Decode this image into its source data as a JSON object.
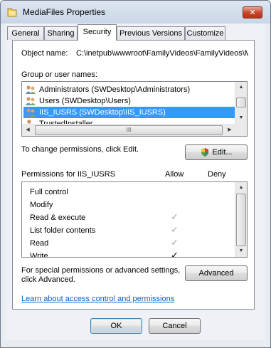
{
  "window": {
    "title": "MediaFiles Properties"
  },
  "tabs": [
    {
      "label": "General"
    },
    {
      "label": "Sharing"
    },
    {
      "label": "Security",
      "active": true
    },
    {
      "label": "Previous Versions"
    },
    {
      "label": "Customize"
    }
  ],
  "object": {
    "label": "Object name:",
    "value": "C:\\inetpub\\wwwroot\\FamilyVideos\\FamilyVideos\\M"
  },
  "groups": {
    "label": "Group or user names:",
    "items": [
      {
        "name": "Administrators (SWDesktop\\Administrators)"
      },
      {
        "name": "Users (SWDesktop\\Users)"
      },
      {
        "name": "IIS_IUSRS (SWDesktop\\IIS_IUSRS)",
        "selected": true
      },
      {
        "name": "TrustedInstaller"
      }
    ],
    "hscroll_grip": "III"
  },
  "change_perms": {
    "text": "To change permissions, click Edit.",
    "edit_label": "Edit..."
  },
  "permissions": {
    "title": "Permissions for IIS_IUSRS",
    "allow_header": "Allow",
    "deny_header": "Deny",
    "rows": [
      {
        "name": "Full control",
        "allow": "none"
      },
      {
        "name": "Modify",
        "allow": "none"
      },
      {
        "name": "Read & execute",
        "allow": "inherited"
      },
      {
        "name": "List folder contents",
        "allow": "inherited"
      },
      {
        "name": "Read",
        "allow": "inherited"
      },
      {
        "name": "Write",
        "allow": "explicit"
      }
    ]
  },
  "advanced": {
    "text_line1": "For special permissions or advanced settings,",
    "text_line2": "click Advanced.",
    "button_label": "Advanced"
  },
  "learn_link": "Learn about access control and permissions",
  "footer": {
    "ok_label": "OK",
    "cancel_label": "Cancel"
  },
  "colors": {
    "selection": "#3399ff",
    "link": "#0066cc",
    "close": "#c7432a"
  }
}
